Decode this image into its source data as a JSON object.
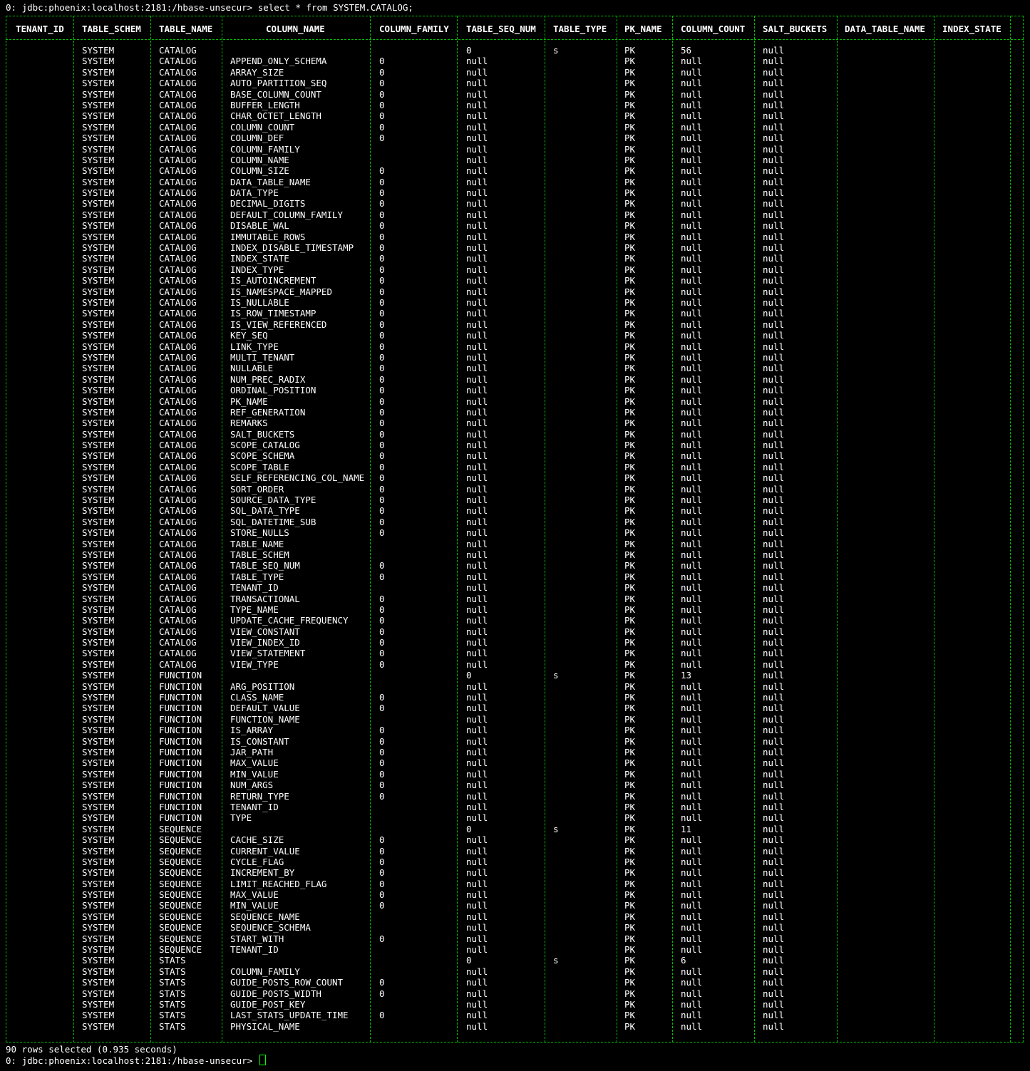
{
  "terminal": {
    "prompt_command": "0: jdbc:phoenix:localhost:2181:/hbase-unsecur> select * from SYSTEM.CATALOG;",
    "rows_selected": "90 rows selected (0.935 seconds)",
    "prompt_end": "0: jdbc:phoenix:localhost:2181:/hbase-unsecur>",
    "colors": {
      "background": "#000000",
      "text": "#ffffff",
      "border": "#00c000",
      "cursor": "#00ff00"
    }
  },
  "table": {
    "headers": [
      "TENANT_ID",
      "TABLE_SCHEM",
      "TABLE_NAME",
      "COLUMN_NAME",
      "COLUMN_FAMILY",
      "TABLE_SEQ_NUM",
      "TABLE_TYPE",
      "PK_NAME",
      "COLUMN_COUNT",
      "SALT_BUCKETS",
      "DATA_TABLE_NAME",
      "INDEX_STATE"
    ],
    "rows": [
      [
        "",
        "SYSTEM",
        "CATALOG",
        "",
        "",
        "0",
        "s",
        "PK",
        "56",
        "null",
        "",
        ""
      ],
      [
        "",
        "SYSTEM",
        "CATALOG",
        "APPEND_ONLY_SCHEMA",
        "0",
        "null",
        "",
        "PK",
        "null",
        "null",
        "",
        ""
      ],
      [
        "",
        "SYSTEM",
        "CATALOG",
        "ARRAY_SIZE",
        "0",
        "null",
        "",
        "PK",
        "null",
        "null",
        "",
        ""
      ],
      [
        "",
        "SYSTEM",
        "CATALOG",
        "AUTO_PARTITION_SEQ",
        "0",
        "null",
        "",
        "PK",
        "null",
        "null",
        "",
        ""
      ],
      [
        "",
        "SYSTEM",
        "CATALOG",
        "BASE_COLUMN_COUNT",
        "0",
        "null",
        "",
        "PK",
        "null",
        "null",
        "",
        ""
      ],
      [
        "",
        "SYSTEM",
        "CATALOG",
        "BUFFER_LENGTH",
        "0",
        "null",
        "",
        "PK",
        "null",
        "null",
        "",
        ""
      ],
      [
        "",
        "SYSTEM",
        "CATALOG",
        "CHAR_OCTET_LENGTH",
        "0",
        "null",
        "",
        "PK",
        "null",
        "null",
        "",
        ""
      ],
      [
        "",
        "SYSTEM",
        "CATALOG",
        "COLUMN_COUNT",
        "0",
        "null",
        "",
        "PK",
        "null",
        "null",
        "",
        ""
      ],
      [
        "",
        "SYSTEM",
        "CATALOG",
        "COLUMN_DEF",
        "0",
        "null",
        "",
        "PK",
        "null",
        "null",
        "",
        ""
      ],
      [
        "",
        "SYSTEM",
        "CATALOG",
        "COLUMN_FAMILY",
        "",
        "null",
        "",
        "PK",
        "null",
        "null",
        "",
        ""
      ],
      [
        "",
        "SYSTEM",
        "CATALOG",
        "COLUMN_NAME",
        "",
        "null",
        "",
        "PK",
        "null",
        "null",
        "",
        ""
      ],
      [
        "",
        "SYSTEM",
        "CATALOG",
        "COLUMN_SIZE",
        "0",
        "null",
        "",
        "PK",
        "null",
        "null",
        "",
        ""
      ],
      [
        "",
        "SYSTEM",
        "CATALOG",
        "DATA_TABLE_NAME",
        "0",
        "null",
        "",
        "PK",
        "null",
        "null",
        "",
        ""
      ],
      [
        "",
        "SYSTEM",
        "CATALOG",
        "DATA_TYPE",
        "0",
        "null",
        "",
        "PK",
        "null",
        "null",
        "",
        ""
      ],
      [
        "",
        "SYSTEM",
        "CATALOG",
        "DECIMAL_DIGITS",
        "0",
        "null",
        "",
        "PK",
        "null",
        "null",
        "",
        ""
      ],
      [
        "",
        "SYSTEM",
        "CATALOG",
        "DEFAULT_COLUMN_FAMILY",
        "0",
        "null",
        "",
        "PK",
        "null",
        "null",
        "",
        ""
      ],
      [
        "",
        "SYSTEM",
        "CATALOG",
        "DISABLE_WAL",
        "0",
        "null",
        "",
        "PK",
        "null",
        "null",
        "",
        ""
      ],
      [
        "",
        "SYSTEM",
        "CATALOG",
        "IMMUTABLE_ROWS",
        "0",
        "null",
        "",
        "PK",
        "null",
        "null",
        "",
        ""
      ],
      [
        "",
        "SYSTEM",
        "CATALOG",
        "INDEX_DISABLE_TIMESTAMP",
        "0",
        "null",
        "",
        "PK",
        "null",
        "null",
        "",
        ""
      ],
      [
        "",
        "SYSTEM",
        "CATALOG",
        "INDEX_STATE",
        "0",
        "null",
        "",
        "PK",
        "null",
        "null",
        "",
        ""
      ],
      [
        "",
        "SYSTEM",
        "CATALOG",
        "INDEX_TYPE",
        "0",
        "null",
        "",
        "PK",
        "null",
        "null",
        "",
        ""
      ],
      [
        "",
        "SYSTEM",
        "CATALOG",
        "IS_AUTOINCREMENT",
        "0",
        "null",
        "",
        "PK",
        "null",
        "null",
        "",
        ""
      ],
      [
        "",
        "SYSTEM",
        "CATALOG",
        "IS_NAMESPACE_MAPPED",
        "0",
        "null",
        "",
        "PK",
        "null",
        "null",
        "",
        ""
      ],
      [
        "",
        "SYSTEM",
        "CATALOG",
        "IS_NULLABLE",
        "0",
        "null",
        "",
        "PK",
        "null",
        "null",
        "",
        ""
      ],
      [
        "",
        "SYSTEM",
        "CATALOG",
        "IS_ROW_TIMESTAMP",
        "0",
        "null",
        "",
        "PK",
        "null",
        "null",
        "",
        ""
      ],
      [
        "",
        "SYSTEM",
        "CATALOG",
        "IS_VIEW_REFERENCED",
        "0",
        "null",
        "",
        "PK",
        "null",
        "null",
        "",
        ""
      ],
      [
        "",
        "SYSTEM",
        "CATALOG",
        "KEY_SEQ",
        "0",
        "null",
        "",
        "PK",
        "null",
        "null",
        "",
        ""
      ],
      [
        "",
        "SYSTEM",
        "CATALOG",
        "LINK_TYPE",
        "0",
        "null",
        "",
        "PK",
        "null",
        "null",
        "",
        ""
      ],
      [
        "",
        "SYSTEM",
        "CATALOG",
        "MULTI_TENANT",
        "0",
        "null",
        "",
        "PK",
        "null",
        "null",
        "",
        ""
      ],
      [
        "",
        "SYSTEM",
        "CATALOG",
        "NULLABLE",
        "0",
        "null",
        "",
        "PK",
        "null",
        "null",
        "",
        ""
      ],
      [
        "",
        "SYSTEM",
        "CATALOG",
        "NUM_PREC_RADIX",
        "0",
        "null",
        "",
        "PK",
        "null",
        "null",
        "",
        ""
      ],
      [
        "",
        "SYSTEM",
        "CATALOG",
        "ORDINAL_POSITION",
        "0",
        "null",
        "",
        "PK",
        "null",
        "null",
        "",
        ""
      ],
      [
        "",
        "SYSTEM",
        "CATALOG",
        "PK_NAME",
        "0",
        "null",
        "",
        "PK",
        "null",
        "null",
        "",
        ""
      ],
      [
        "",
        "SYSTEM",
        "CATALOG",
        "REF_GENERATION",
        "0",
        "null",
        "",
        "PK",
        "null",
        "null",
        "",
        ""
      ],
      [
        "",
        "SYSTEM",
        "CATALOG",
        "REMARKS",
        "0",
        "null",
        "",
        "PK",
        "null",
        "null",
        "",
        ""
      ],
      [
        "",
        "SYSTEM",
        "CATALOG",
        "SALT_BUCKETS",
        "0",
        "null",
        "",
        "PK",
        "null",
        "null",
        "",
        ""
      ],
      [
        "",
        "SYSTEM",
        "CATALOG",
        "SCOPE_CATALOG",
        "0",
        "null",
        "",
        "PK",
        "null",
        "null",
        "",
        ""
      ],
      [
        "",
        "SYSTEM",
        "CATALOG",
        "SCOPE_SCHEMA",
        "0",
        "null",
        "",
        "PK",
        "null",
        "null",
        "",
        ""
      ],
      [
        "",
        "SYSTEM",
        "CATALOG",
        "SCOPE_TABLE",
        "0",
        "null",
        "",
        "PK",
        "null",
        "null",
        "",
        ""
      ],
      [
        "",
        "SYSTEM",
        "CATALOG",
        "SELF_REFERENCING_COL_NAME",
        "0",
        "null",
        "",
        "PK",
        "null",
        "null",
        "",
        ""
      ],
      [
        "",
        "SYSTEM",
        "CATALOG",
        "SORT_ORDER",
        "0",
        "null",
        "",
        "PK",
        "null",
        "null",
        "",
        ""
      ],
      [
        "",
        "SYSTEM",
        "CATALOG",
        "SOURCE_DATA_TYPE",
        "0",
        "null",
        "",
        "PK",
        "null",
        "null",
        "",
        ""
      ],
      [
        "",
        "SYSTEM",
        "CATALOG",
        "SQL_DATA_TYPE",
        "0",
        "null",
        "",
        "PK",
        "null",
        "null",
        "",
        ""
      ],
      [
        "",
        "SYSTEM",
        "CATALOG",
        "SQL_DATETIME_SUB",
        "0",
        "null",
        "",
        "PK",
        "null",
        "null",
        "",
        ""
      ],
      [
        "",
        "SYSTEM",
        "CATALOG",
        "STORE_NULLS",
        "0",
        "null",
        "",
        "PK",
        "null",
        "null",
        "",
        ""
      ],
      [
        "",
        "SYSTEM",
        "CATALOG",
        "TABLE_NAME",
        "",
        "null",
        "",
        "PK",
        "null",
        "null",
        "",
        ""
      ],
      [
        "",
        "SYSTEM",
        "CATALOG",
        "TABLE_SCHEM",
        "",
        "null",
        "",
        "PK",
        "null",
        "null",
        "",
        ""
      ],
      [
        "",
        "SYSTEM",
        "CATALOG",
        "TABLE_SEQ_NUM",
        "0",
        "null",
        "",
        "PK",
        "null",
        "null",
        "",
        ""
      ],
      [
        "",
        "SYSTEM",
        "CATALOG",
        "TABLE_TYPE",
        "0",
        "null",
        "",
        "PK",
        "null",
        "null",
        "",
        ""
      ],
      [
        "",
        "SYSTEM",
        "CATALOG",
        "TENANT_ID",
        "",
        "null",
        "",
        "PK",
        "null",
        "null",
        "",
        ""
      ],
      [
        "",
        "SYSTEM",
        "CATALOG",
        "TRANSACTIONAL",
        "0",
        "null",
        "",
        "PK",
        "null",
        "null",
        "",
        ""
      ],
      [
        "",
        "SYSTEM",
        "CATALOG",
        "TYPE_NAME",
        "0",
        "null",
        "",
        "PK",
        "null",
        "null",
        "",
        ""
      ],
      [
        "",
        "SYSTEM",
        "CATALOG",
        "UPDATE_CACHE_FREQUENCY",
        "0",
        "null",
        "",
        "PK",
        "null",
        "null",
        "",
        ""
      ],
      [
        "",
        "SYSTEM",
        "CATALOG",
        "VIEW_CONSTANT",
        "0",
        "null",
        "",
        "PK",
        "null",
        "null",
        "",
        ""
      ],
      [
        "",
        "SYSTEM",
        "CATALOG",
        "VIEW_INDEX_ID",
        "0",
        "null",
        "",
        "PK",
        "null",
        "null",
        "",
        ""
      ],
      [
        "",
        "SYSTEM",
        "CATALOG",
        "VIEW_STATEMENT",
        "0",
        "null",
        "",
        "PK",
        "null",
        "null",
        "",
        ""
      ],
      [
        "",
        "SYSTEM",
        "CATALOG",
        "VIEW_TYPE",
        "0",
        "null",
        "",
        "PK",
        "null",
        "null",
        "",
        ""
      ],
      [
        "",
        "SYSTEM",
        "FUNCTION",
        "",
        "",
        "0",
        "s",
        "PK",
        "13",
        "null",
        "",
        ""
      ],
      [
        "",
        "SYSTEM",
        "FUNCTION",
        "ARG_POSITION",
        "",
        "null",
        "",
        "PK",
        "null",
        "null",
        "",
        ""
      ],
      [
        "",
        "SYSTEM",
        "FUNCTION",
        "CLASS_NAME",
        "0",
        "null",
        "",
        "PK",
        "null",
        "null",
        "",
        ""
      ],
      [
        "",
        "SYSTEM",
        "FUNCTION",
        "DEFAULT_VALUE",
        "0",
        "null",
        "",
        "PK",
        "null",
        "null",
        "",
        ""
      ],
      [
        "",
        "SYSTEM",
        "FUNCTION",
        "FUNCTION_NAME",
        "",
        "null",
        "",
        "PK",
        "null",
        "null",
        "",
        ""
      ],
      [
        "",
        "SYSTEM",
        "FUNCTION",
        "IS_ARRAY",
        "0",
        "null",
        "",
        "PK",
        "null",
        "null",
        "",
        ""
      ],
      [
        "",
        "SYSTEM",
        "FUNCTION",
        "IS_CONSTANT",
        "0",
        "null",
        "",
        "PK",
        "null",
        "null",
        "",
        ""
      ],
      [
        "",
        "SYSTEM",
        "FUNCTION",
        "JAR_PATH",
        "0",
        "null",
        "",
        "PK",
        "null",
        "null",
        "",
        ""
      ],
      [
        "",
        "SYSTEM",
        "FUNCTION",
        "MAX_VALUE",
        "0",
        "null",
        "",
        "PK",
        "null",
        "null",
        "",
        ""
      ],
      [
        "",
        "SYSTEM",
        "FUNCTION",
        "MIN_VALUE",
        "0",
        "null",
        "",
        "PK",
        "null",
        "null",
        "",
        ""
      ],
      [
        "",
        "SYSTEM",
        "FUNCTION",
        "NUM_ARGS",
        "0",
        "null",
        "",
        "PK",
        "null",
        "null",
        "",
        ""
      ],
      [
        "",
        "SYSTEM",
        "FUNCTION",
        "RETURN_TYPE",
        "0",
        "null",
        "",
        "PK",
        "null",
        "null",
        "",
        ""
      ],
      [
        "",
        "SYSTEM",
        "FUNCTION",
        "TENANT_ID",
        "",
        "null",
        "",
        "PK",
        "null",
        "null",
        "",
        ""
      ],
      [
        "",
        "SYSTEM",
        "FUNCTION",
        "TYPE",
        "",
        "null",
        "",
        "PK",
        "null",
        "null",
        "",
        ""
      ],
      [
        "",
        "SYSTEM",
        "SEQUENCE",
        "",
        "",
        "0",
        "s",
        "PK",
        "11",
        "null",
        "",
        ""
      ],
      [
        "",
        "SYSTEM",
        "SEQUENCE",
        "CACHE_SIZE",
        "0",
        "null",
        "",
        "PK",
        "null",
        "null",
        "",
        ""
      ],
      [
        "",
        "SYSTEM",
        "SEQUENCE",
        "CURRENT_VALUE",
        "0",
        "null",
        "",
        "PK",
        "null",
        "null",
        "",
        ""
      ],
      [
        "",
        "SYSTEM",
        "SEQUENCE",
        "CYCLE_FLAG",
        "0",
        "null",
        "",
        "PK",
        "null",
        "null",
        "",
        ""
      ],
      [
        "",
        "SYSTEM",
        "SEQUENCE",
        "INCREMENT_BY",
        "0",
        "null",
        "",
        "PK",
        "null",
        "null",
        "",
        ""
      ],
      [
        "",
        "SYSTEM",
        "SEQUENCE",
        "LIMIT_REACHED_FLAG",
        "0",
        "null",
        "",
        "PK",
        "null",
        "null",
        "",
        ""
      ],
      [
        "",
        "SYSTEM",
        "SEQUENCE",
        "MAX_VALUE",
        "0",
        "null",
        "",
        "PK",
        "null",
        "null",
        "",
        ""
      ],
      [
        "",
        "SYSTEM",
        "SEQUENCE",
        "MIN_VALUE",
        "0",
        "null",
        "",
        "PK",
        "null",
        "null",
        "",
        ""
      ],
      [
        "",
        "SYSTEM",
        "SEQUENCE",
        "SEQUENCE_NAME",
        "",
        "null",
        "",
        "PK",
        "null",
        "null",
        "",
        ""
      ],
      [
        "",
        "SYSTEM",
        "SEQUENCE",
        "SEQUENCE_SCHEMA",
        "",
        "null",
        "",
        "PK",
        "null",
        "null",
        "",
        ""
      ],
      [
        "",
        "SYSTEM",
        "SEQUENCE",
        "START_WITH",
        "0",
        "null",
        "",
        "PK",
        "null",
        "null",
        "",
        ""
      ],
      [
        "",
        "SYSTEM",
        "SEQUENCE",
        "TENANT_ID",
        "",
        "null",
        "",
        "PK",
        "null",
        "null",
        "",
        ""
      ],
      [
        "",
        "SYSTEM",
        "STATS",
        "",
        "",
        "0",
        "s",
        "PK",
        "6",
        "null",
        "",
        ""
      ],
      [
        "",
        "SYSTEM",
        "STATS",
        "COLUMN_FAMILY",
        "",
        "null",
        "",
        "PK",
        "null",
        "null",
        "",
        ""
      ],
      [
        "",
        "SYSTEM",
        "STATS",
        "GUIDE_POSTS_ROW_COUNT",
        "0",
        "null",
        "",
        "PK",
        "null",
        "null",
        "",
        ""
      ],
      [
        "",
        "SYSTEM",
        "STATS",
        "GUIDE_POSTS_WIDTH",
        "0",
        "null",
        "",
        "PK",
        "null",
        "null",
        "",
        ""
      ],
      [
        "",
        "SYSTEM",
        "STATS",
        "GUIDE_POST_KEY",
        "",
        "null",
        "",
        "PK",
        "null",
        "null",
        "",
        ""
      ],
      [
        "",
        "SYSTEM",
        "STATS",
        "LAST_STATS_UPDATE_TIME",
        "0",
        "null",
        "",
        "PK",
        "null",
        "null",
        "",
        ""
      ],
      [
        "",
        "SYSTEM",
        "STATS",
        "PHYSICAL_NAME",
        "",
        "null",
        "",
        "PK",
        "null",
        "null",
        "",
        ""
      ]
    ]
  }
}
